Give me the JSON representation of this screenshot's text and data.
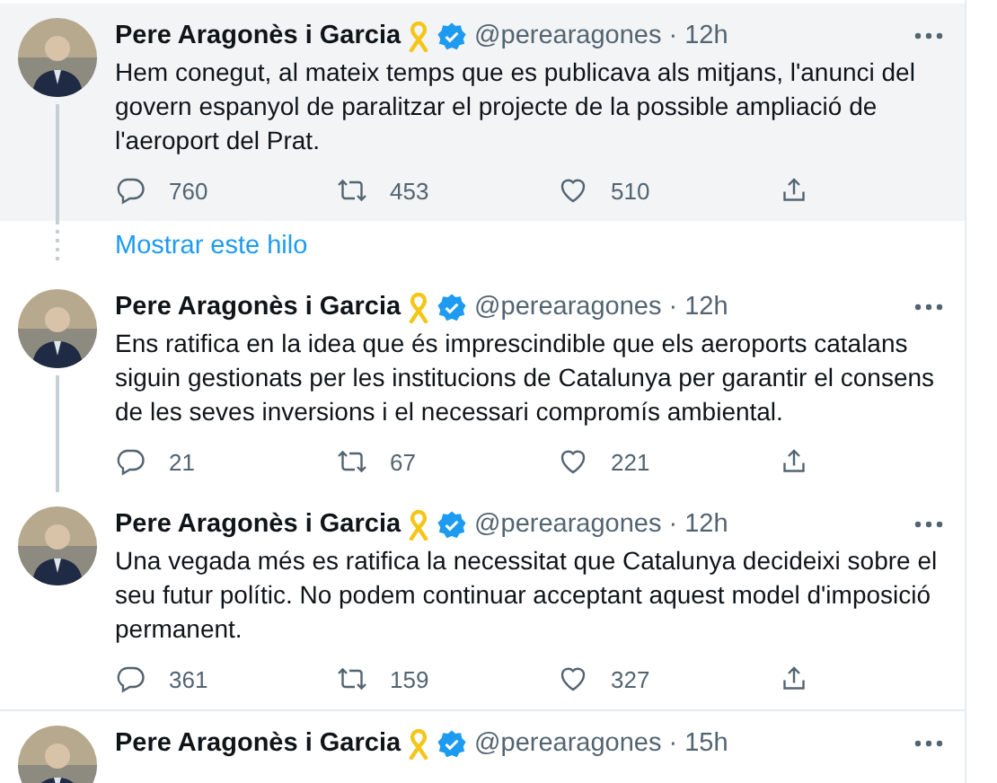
{
  "feed": [
    {
      "kind": "tweet",
      "name": "Pere Aragonès i Garcia",
      "handle": "@perearagones",
      "separator": "·",
      "time": "12h",
      "text": "Hem conegut, al mateix temps que es publicava als mitjans, l'anunci del govern espanyol de paralitzar el projecte de la possible ampliació de l'aeroport del Prat.",
      "replies": "760",
      "retweets": "453",
      "likes": "510",
      "highlighted": true,
      "thread_line": true
    },
    {
      "kind": "show_thread",
      "label": "Mostrar este hilo"
    },
    {
      "kind": "tweet",
      "name": "Pere Aragonès i Garcia",
      "handle": "@perearagones",
      "separator": "·",
      "time": "12h",
      "text": "Ens ratifica en la idea que és imprescindible que els aeroports catalans siguin gestionats per les institucions de Catalunya per garantir el consens de les seves inversions i el necessari compromís ambiental.",
      "replies": "21",
      "retweets": "67",
      "likes": "221",
      "highlighted": false,
      "thread_line": true
    },
    {
      "kind": "tweet",
      "name": "Pere Aragonès i Garcia",
      "handle": "@perearagones",
      "separator": "·",
      "time": "12h",
      "text": "Una vegada més es ratifica la necessitat que Catalunya decideixi sobre el seu futur polític. No podem continuar acceptant aquest model d'imposició permanent.",
      "replies": "361",
      "retweets": "159",
      "likes": "327",
      "highlighted": false,
      "thread_line": false
    },
    {
      "kind": "tweet",
      "name": "Pere Aragonès i Garcia",
      "handle": "@perearagones",
      "separator": "·",
      "time": "15h",
      "highlighted": false,
      "thread_line": false
    }
  ]
}
